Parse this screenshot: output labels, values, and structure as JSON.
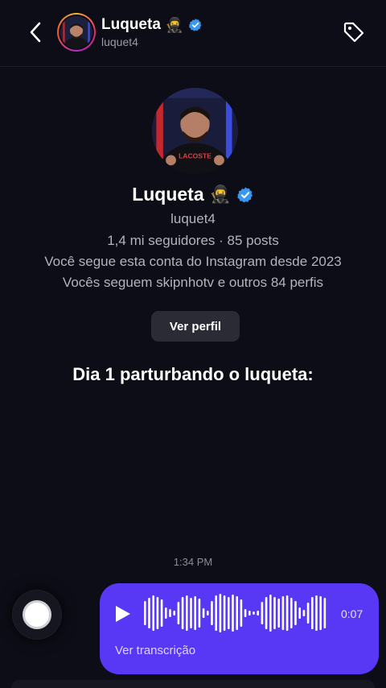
{
  "header": {
    "name": "Luqueta",
    "emoji": "🥷",
    "username": "luquet4"
  },
  "profile": {
    "name": "Luqueta",
    "emoji": "🥷",
    "username": "luquet4",
    "stats": "1,4 mi seguidores · 85 posts",
    "follow_since": "Você segue esta conta do Instagram desde 2023",
    "mutuals": "Vocês seguem skipnhotv e outros 84 perfis",
    "view_profile_label": "Ver perfil",
    "shirt_text": "LACOSTE"
  },
  "caption": "Dia 1 parturbando o luqueta:",
  "message": {
    "timestamp": "1:34 PM",
    "voice": {
      "duration": "0:07",
      "transcript_label": "Ver transcrição"
    }
  },
  "colors": {
    "background": "#0c0d16",
    "bubble": "#5838f4",
    "verified": "#3897f0"
  }
}
